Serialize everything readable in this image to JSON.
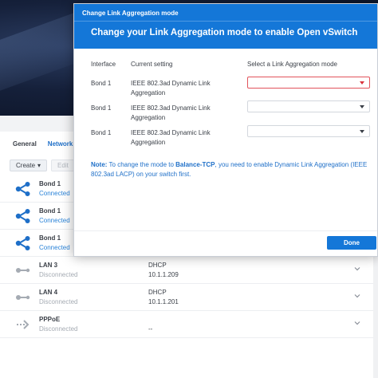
{
  "background": {
    "tabs": [
      {
        "label": "General"
      },
      {
        "label": "Network"
      }
    ],
    "toolbar": {
      "create_label": "Create",
      "edit_label": "Edit"
    },
    "rows": [
      {
        "name": "Bond 1",
        "status": "Connected",
        "col1": "",
        "col2": "",
        "icon": "bond-share-icon"
      },
      {
        "name": "Bond 1",
        "status": "Connected",
        "col1": "",
        "col2": "",
        "icon": "bond-share-icon"
      },
      {
        "name": "Bond 1",
        "status": "Connected",
        "col1": "",
        "col2": "",
        "icon": "bond-share-icon"
      },
      {
        "name": "LAN 3",
        "status": "Disconnected",
        "col1": "DHCP",
        "col2": "10.1.1.209",
        "icon": "lan-icon"
      },
      {
        "name": "LAN 4",
        "status": "Disconnected",
        "col1": "DHCP",
        "col2": "10.1.1.201",
        "icon": "lan-icon"
      },
      {
        "name": "PPPoE",
        "status": "Disconnected",
        "col1": "",
        "col2": "--",
        "icon": "pppoe-icon"
      }
    ]
  },
  "dialog": {
    "title": "Change Link Aggregation mode",
    "banner": "Change your Link Aggregation mode to enable Open vSwitch",
    "headers": {
      "interface": "Interface",
      "current": "Current setting",
      "select": "Select a Link Aggregation mode"
    },
    "rows": [
      {
        "interface": "Bond 1",
        "current_line1": "IEEE 802.3ad Dynamic Link",
        "current_line2": "Aggregation",
        "selected": "",
        "error": true
      },
      {
        "interface": "Bond 1",
        "current_line1": "IEEE 802.3ad Dynamic Link",
        "current_line2": "Aggregation",
        "selected": "",
        "error": false
      },
      {
        "interface": "Bond 1",
        "current_line1": "IEEE 802.3ad Dynamic Link",
        "current_line2": "Aggregation",
        "selected": "",
        "error": false
      }
    ],
    "note": {
      "label": "Note:",
      "text_before": " To change the mode to ",
      "emphasis": "Balance-TCP",
      "text_after": ", you need to enable Dynamic Link Aggregation (IEEE 802.3ad LACP) on your switch first."
    },
    "done_label": "Done"
  },
  "colors": {
    "accent": "#1477d8",
    "link": "#1e6fc8",
    "error": "#e2535b",
    "connected": "#2a83d8",
    "disconnected": "#a5abb3"
  }
}
